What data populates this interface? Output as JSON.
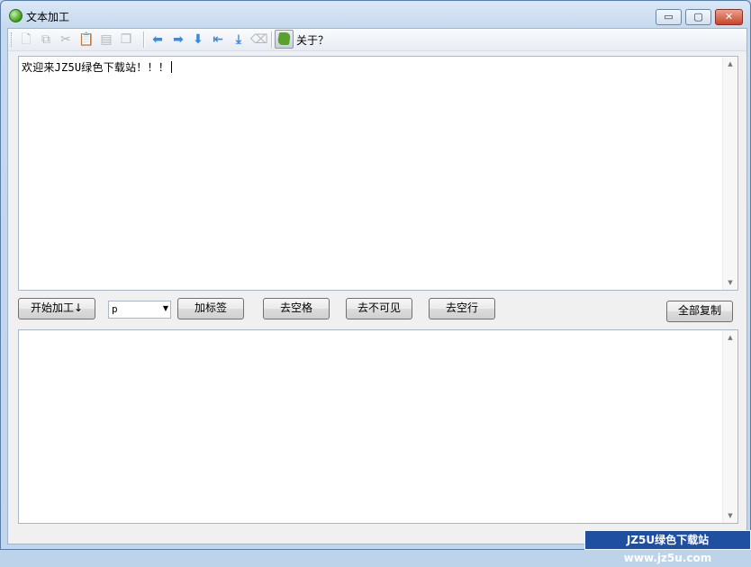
{
  "window": {
    "title": "文本加工",
    "minimize_glyph": "▭",
    "maximize_glyph": "▢",
    "close_glyph": "✕"
  },
  "toolbar": {
    "icons": [
      {
        "name": "new-icon",
        "glyph": "🗋",
        "style": "dim"
      },
      {
        "name": "copy-icon",
        "glyph": "⧉",
        "style": "dim"
      },
      {
        "name": "cut-icon",
        "glyph": "✂",
        "style": "dim"
      },
      {
        "name": "paste-icon",
        "glyph": "📋",
        "style": "dim"
      },
      {
        "name": "note-icon",
        "glyph": "▤",
        "style": "dim"
      },
      {
        "name": "duplicate-icon",
        "glyph": "❐",
        "style": "dim"
      },
      {
        "name": "arrow-left-icon",
        "glyph": "⬅",
        "style": "arrow"
      },
      {
        "name": "arrow-right-icon",
        "glyph": "➡",
        "style": "arrow"
      },
      {
        "name": "arrow-down-icon",
        "glyph": "⬇",
        "style": "arrow"
      },
      {
        "name": "arrow-first-icon",
        "glyph": "⇤",
        "style": "arrow"
      },
      {
        "name": "download-icon",
        "glyph": "⤓",
        "style": "arrow"
      },
      {
        "name": "clear-icon",
        "glyph": "⌫",
        "style": "dim"
      }
    ],
    "about_label": "关于？"
  },
  "input": {
    "text": "欢迎来JZ5U绿色下载站！！！"
  },
  "controls": {
    "start_label": "开始加工↓",
    "tag_select_value": "p",
    "add_tag_label": "加标签",
    "remove_spaces_label": "去空格",
    "remove_invisible_label": "去不可见",
    "remove_blank_lines_label": "去空行",
    "copy_all_label": "全部复制"
  },
  "output": {
    "text": ""
  },
  "watermark": {
    "text": "JZ5U绿色下载站www.jz5u.com"
  }
}
